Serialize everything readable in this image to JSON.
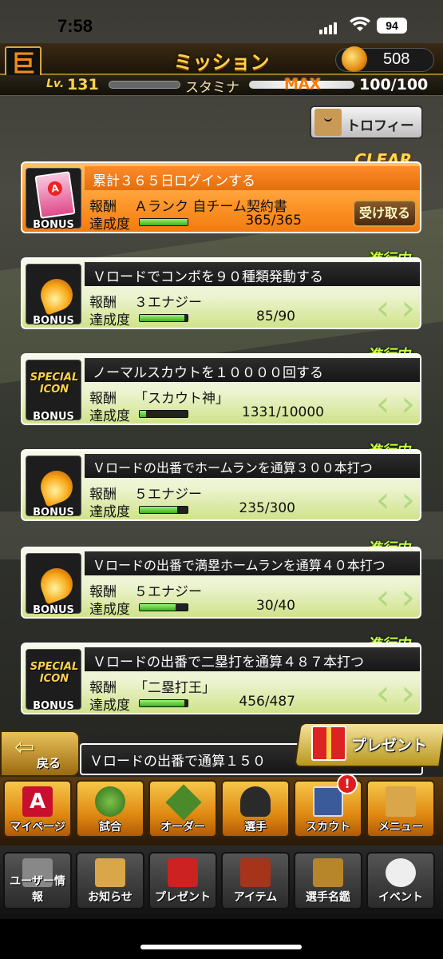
{
  "status": {
    "time": "7:58",
    "battery": "94"
  },
  "header": {
    "title": "ミッション",
    "energy": "508",
    "logo": "巨"
  },
  "level": {
    "label": "Lv.",
    "value": "131",
    "stamina_label": "スタミナ",
    "max_label": "MAX",
    "stamina": "100/100"
  },
  "trophy_button": "トロフィー",
  "missions": [
    {
      "title": "累計３６５日ログインする",
      "reward_label": "報酬",
      "reward": "Ａランク 自チーム契約書",
      "progress_label": "達成度",
      "progress": "365/365",
      "fraction": 1.0,
      "status": "CLEAR",
      "button": "受け取る",
      "bonus": "BONUS",
      "icon_text": "自チーム"
    },
    {
      "title": "Ｖロードでコンボを９０種類発動する",
      "reward_label": "報酬",
      "reward": "３エナジー",
      "progress_label": "達成度",
      "progress": "85/90",
      "fraction": 0.94,
      "status": "進行中",
      "bonus": "BONUS"
    },
    {
      "title": "ノーマルスカウトを１００００回する",
      "reward_label": "報酬",
      "reward": "「スカウト神」",
      "progress_label": "達成度",
      "progress": "1331/10000",
      "fraction": 0.13,
      "status": "進行中",
      "bonus": "BONUS",
      "icon_text": "SPECIAL ICON"
    },
    {
      "title": "Ｖロードの出番でホームランを通算３００本打つ",
      "reward_label": "報酬",
      "reward": "５エナジー",
      "progress_label": "達成度",
      "progress": "235/300",
      "fraction": 0.78,
      "status": "進行中",
      "bonus": "BONUS"
    },
    {
      "title": "Ｖロードの出番で満塁ホームランを通算４０本打つ",
      "reward_label": "報酬",
      "reward": "５エナジー",
      "progress_label": "達成度",
      "progress": "30/40",
      "fraction": 0.75,
      "status": "進行中",
      "bonus": "BONUS"
    },
    {
      "title": "Ｖロードの出番で二塁打を通算４８７本打つ",
      "reward_label": "報酬",
      "reward": "「二塁打王」",
      "progress_label": "達成度",
      "progress": "456/487",
      "fraction": 0.94,
      "status": "進行中",
      "bonus": "BONUS",
      "icon_text": "SPECIAL ICON"
    }
  ],
  "partial_mission": "Ｖロードの出番で通算１５０",
  "back_button": "戻る",
  "present_button": "プレゼント",
  "nav_primary": [
    "マイページ",
    "試合",
    "オーダー",
    "選手",
    "スカウト",
    "メニュー"
  ],
  "scout_badge": "!",
  "nav_secondary": [
    "ユーザー情報",
    "お知らせ",
    "プレゼント",
    "アイテム",
    "選手名鑑",
    "イベント"
  ],
  "colors": {
    "accent": "#ffd24a",
    "clear": "#ff9a2e",
    "progress_green": "#3ab01a",
    "in_progress_tag": "#c6ff43"
  }
}
